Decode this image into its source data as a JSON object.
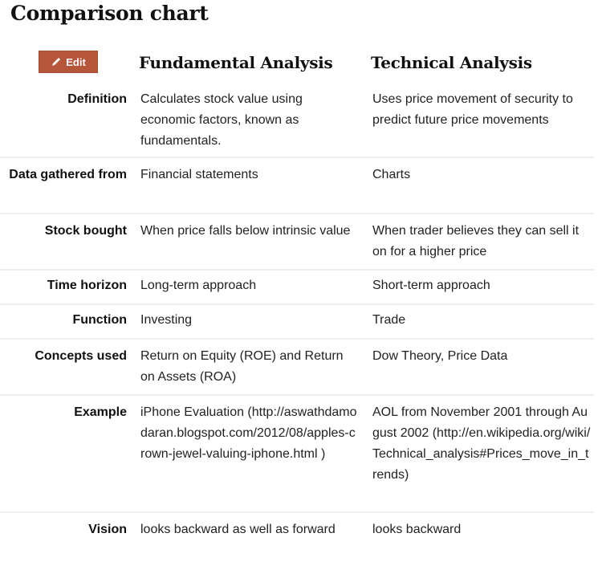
{
  "title": "Comparison chart",
  "edit_button": {
    "label": "Edit",
    "icon": "pencil-icon",
    "color": "#b5553a"
  },
  "columns": [
    "Fundamental Analysis",
    "Technical Analysis"
  ],
  "rows": [
    {
      "label": "Definition",
      "fundamental": "Calculates stock value using economic factors, known as fundamentals.",
      "technical": "Uses price movement of security to predict future price movements"
    },
    {
      "label": "Data gathered from",
      "fundamental": "Financial statements",
      "technical": "Charts"
    },
    {
      "label": "Stock bought",
      "fundamental": "When price falls below intrinsic value",
      "technical": "When trader believes they can sell it on for a higher price"
    },
    {
      "label": "Time horizon",
      "fundamental": "Long-term approach",
      "technical": "Short-term approach"
    },
    {
      "label": "Function",
      "fundamental": "Investing",
      "technical": "Trade"
    },
    {
      "label": "Concepts used",
      "fundamental": "Return on Equity (ROE) and Return on Assets (ROA)",
      "technical": "Dow Theory, Price Data"
    },
    {
      "label": "Example",
      "fundamental": "iPhone Evaluation (http://aswathdamodaran.blogspot.com/2012/08/apples-crown-jewel-valuing-iphone.html )",
      "technical": "AOL from November 2001 through August 2002 (http://en.wikipedia.org/wiki/Technical_analysis#Prices_move_in_trends)"
    },
    {
      "label": "Vision",
      "fundamental": "looks backward as well as forward",
      "technical": "looks backward"
    }
  ]
}
